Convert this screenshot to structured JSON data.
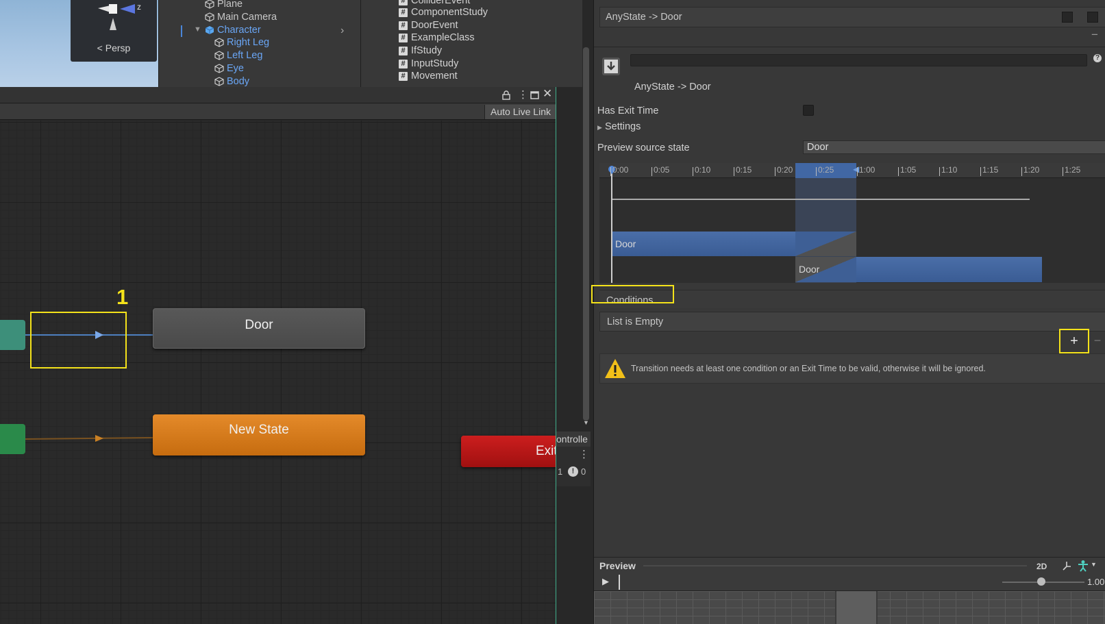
{
  "scene": {
    "persp_label": "Persp",
    "axis_label": "z"
  },
  "hierarchy": {
    "items": [
      {
        "label": "Plane",
        "indent": 0,
        "selected": false
      },
      {
        "label": "Main Camera",
        "indent": 0,
        "selected": false
      },
      {
        "label": "Character",
        "indent": 0,
        "selected": true
      },
      {
        "label": "Right Leg",
        "indent": 1,
        "selected": true
      },
      {
        "label": "Left Leg",
        "indent": 1,
        "selected": true
      },
      {
        "label": "Eye",
        "indent": 1,
        "selected": true
      },
      {
        "label": "Body",
        "indent": 1,
        "selected": true
      }
    ]
  },
  "project": {
    "files": [
      "ColliderEvent",
      "ComponentStudy",
      "DoorEvent",
      "ExampleClass",
      "IfStudy",
      "InputStudy",
      "Movement"
    ]
  },
  "animator": {
    "auto_live_link": "Auto Live Link",
    "states": {
      "door": "Door",
      "new_state": "New State",
      "exit": "Exit"
    },
    "annotation_marker": "1",
    "partial_label": "ontrolle",
    "counts": {
      "a": "1",
      "b": "0"
    }
  },
  "inspector": {
    "transition_list_item": "AnyState -> Door",
    "title": "AnyState -> Door",
    "has_exit_time_label": "Has Exit Time",
    "has_exit_time": false,
    "settings_label": "Settings",
    "preview_source_label": "Preview source state",
    "preview_source_value": "Door",
    "timeline": {
      "ticks": [
        "0:00",
        "0:05",
        "0:10",
        "0:15",
        "0:20",
        "0:25",
        "1:00",
        "1:05",
        "1:10",
        "1:15",
        "1:20",
        "1:25"
      ],
      "clip_a": "Door",
      "clip_b": "Door"
    },
    "conditions_label": "Conditions",
    "conditions_empty": "List is Empty",
    "add_label": "+",
    "remove_label": "−",
    "warning": "Transition needs at least one condition or an Exit Time to be valid, otherwise it will be ignored.",
    "preview": {
      "title": "Preview",
      "mode_2d": "2D",
      "speed": "1.00"
    }
  },
  "colors": {
    "highlight": "#f4e21a",
    "selection_blue": "#6aa6f5",
    "state_orange": "#d97a1c",
    "state_exit": "#b51616"
  }
}
